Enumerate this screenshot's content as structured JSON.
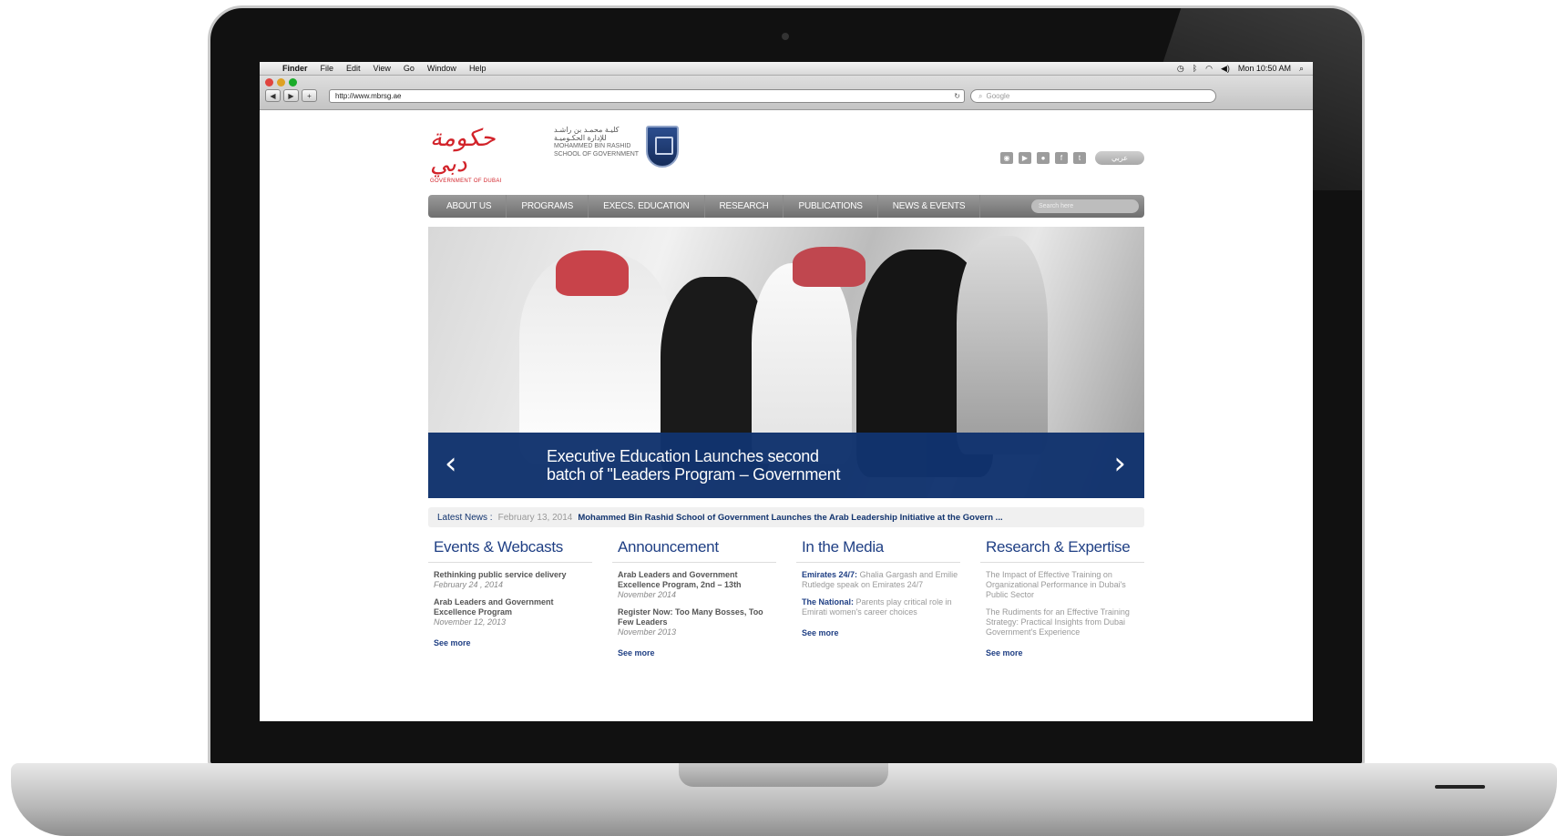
{
  "menubar": {
    "items": [
      "Finder",
      "File",
      "Edit",
      "View",
      "Go",
      "Window",
      "Help"
    ],
    "clock": "Mon 10:50 AM"
  },
  "browser": {
    "url": "http://www.mbrsg.ae",
    "search_placeholder": "Google"
  },
  "header": {
    "dubai_arabic": "حكومة دبي",
    "dubai_english": "GOVERNMENT OF DUBAI",
    "school_arabic_1": "كليـة محمـد بن راشـد",
    "school_arabic_2": "للإدارة الحكـوميـة",
    "school_english_1": "MOHAMMED BIN RASHID",
    "school_english_2": "SCHOOL OF GOVERNMENT",
    "lang_toggle": "عربي"
  },
  "nav": {
    "items": [
      "About Us",
      "Programs",
      "Execs. Education",
      "Research",
      "Publications",
      "News & Events"
    ],
    "search_placeholder": "Search here"
  },
  "hero": {
    "caption_line1": "Executive Education Launches second",
    "caption_line2": "batch of \"Leaders Program – Government"
  },
  "latest": {
    "label": "Latest News :",
    "date": "February 13, 2014",
    "headline": "Mohammed Bin Rashid School of Government Launches the Arab Leadership Initiative at the Govern ..."
  },
  "columns": {
    "events": {
      "title": "Events & Webcasts",
      "e1_title": "Rethinking public service delivery",
      "e1_date": "February 24 , 2014",
      "e2_title": "Arab Leaders and Government Excellence Program",
      "e2_date": "November 12, 2013",
      "more": "See more"
    },
    "announcement": {
      "title": "Announcement",
      "e1_title": "Arab Leaders and Government Excellence Program, 2nd – 13th",
      "e1_date": "November 2014",
      "e2_title": "Register Now: Too Many Bosses, Too Few Leaders",
      "e2_date": "November 2013",
      "more": "See more"
    },
    "media": {
      "title": "In the Media",
      "e1_src": "Emirates 24/7:",
      "e1_text": "Ghalia Gargash and Emilie Rutledge speak on Emirates 24/7",
      "e2_src": "The National:",
      "e2_text": "Parents play critical role in Emirati women's career choices",
      "more": "See more"
    },
    "research": {
      "title": "Research & Expertise",
      "e1_text": "The Impact of Effective Training on Organizational Performance in Dubai's Public Sector",
      "e2_text": "The Rudiments for an Effective Training Strategy: Practical Insights from Dubai Government's Experience",
      "more": "See more"
    }
  }
}
